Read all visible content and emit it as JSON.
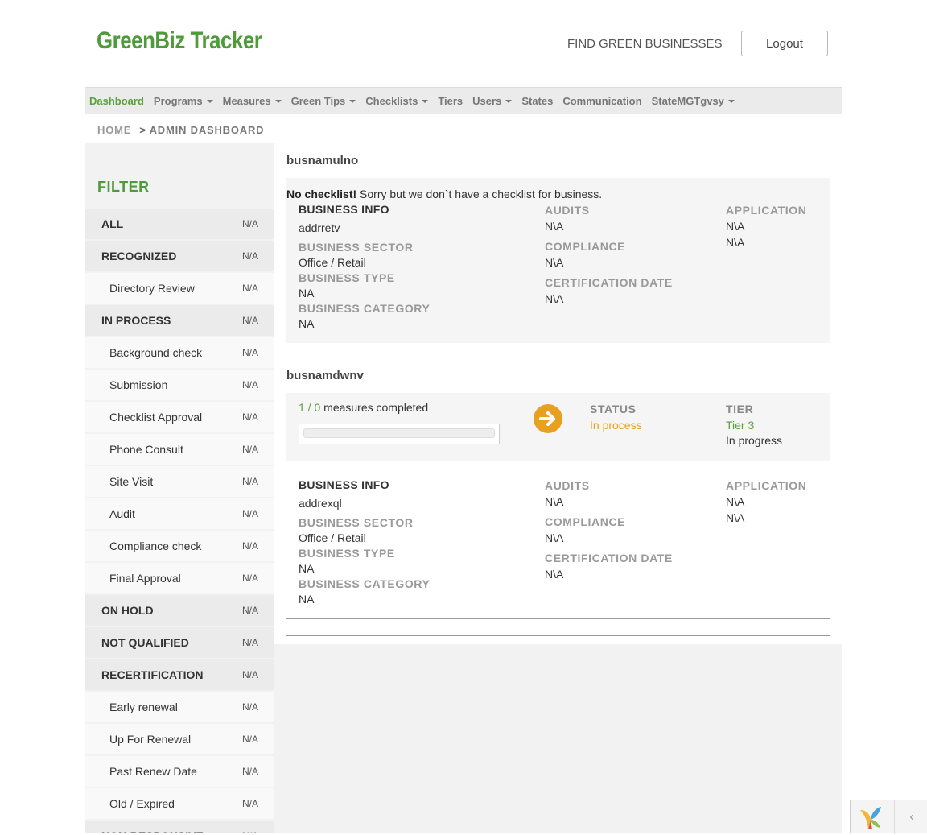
{
  "header": {
    "logo": "GreenBiz Tracker",
    "find_link": "FIND GREEN BUSINESSES",
    "logout": "Logout"
  },
  "nav": [
    {
      "label": "Dashboard",
      "active": true,
      "dropdown": false
    },
    {
      "label": "Programs",
      "dropdown": true
    },
    {
      "label": "Measures",
      "dropdown": true
    },
    {
      "label": "Green Tips",
      "dropdown": true
    },
    {
      "label": "Checklists",
      "dropdown": true
    },
    {
      "label": "Tiers",
      "dropdown": false
    },
    {
      "label": "Users",
      "dropdown": true
    },
    {
      "label": "States",
      "dropdown": false
    },
    {
      "label": "Communication",
      "dropdown": false
    },
    {
      "label": "StateMGTgvsy",
      "dropdown": true
    }
  ],
  "breadcrumb": {
    "home": "HOME",
    "separator": ">",
    "current": "ADMIN DASHBOARD"
  },
  "filter": {
    "title": "FILTER",
    "items": [
      {
        "label": "ALL",
        "value": "N/A",
        "level": "main"
      },
      {
        "label": "RECOGNIZED",
        "value": "N/A",
        "level": "main"
      },
      {
        "label": "Directory Review",
        "value": "N/A",
        "level": "sub"
      },
      {
        "label": "IN PROCESS",
        "value": "N/A",
        "level": "main"
      },
      {
        "label": "Background check",
        "value": "N/A",
        "level": "sub"
      },
      {
        "label": "Submission",
        "value": "N/A",
        "level": "sub"
      },
      {
        "label": "Checklist Approval",
        "value": "N/A",
        "level": "sub"
      },
      {
        "label": "Phone Consult",
        "value": "N/A",
        "level": "sub"
      },
      {
        "label": "Site Visit",
        "value": "N/A",
        "level": "sub"
      },
      {
        "label": "Audit",
        "value": "N/A",
        "level": "sub"
      },
      {
        "label": "Compliance check",
        "value": "N/A",
        "level": "sub"
      },
      {
        "label": "Final Approval",
        "value": "N/A",
        "level": "sub"
      },
      {
        "label": "ON HOLD",
        "value": "N/A",
        "level": "main"
      },
      {
        "label": "NOT QUALIFIED",
        "value": "N/A",
        "level": "main"
      },
      {
        "label": "RECERTIFICATION",
        "value": "N/A",
        "level": "main"
      },
      {
        "label": "Early renewal",
        "value": "N/A",
        "level": "sub"
      },
      {
        "label": "Up For Renewal",
        "value": "N/A",
        "level": "sub"
      },
      {
        "label": "Past Renew Date",
        "value": "N/A",
        "level": "sub"
      },
      {
        "label": "Old / Expired",
        "value": "N/A",
        "level": "sub"
      },
      {
        "label": "NON-RESPONSIVE",
        "value": "N/A",
        "level": "main"
      }
    ]
  },
  "businesses": [
    {
      "name": "busnamulno",
      "notice_bold": "No checklist!",
      "notice_text": " Sorry but we don`t have a checklist for business.",
      "business_info_label": "BUSINESS INFO",
      "address": "addrretv",
      "sector_label": "BUSINESS SECTOR",
      "sector": "Office / Retail",
      "type_label": "BUSINESS TYPE",
      "type": "NA",
      "category_label": "BUSINESS CATEGORY",
      "category": "NA",
      "audits_label": "AUDITS",
      "audits": "N\\A",
      "compliance_label": "COMPLIANCE",
      "compliance": "N\\A",
      "cert_label": "CERTIFICATION DATE",
      "cert_date": "N\\A",
      "application_label": "APPLICATION",
      "application_1": "N\\A",
      "application_2": "N\\A"
    },
    {
      "name": "busnamdwnv",
      "measures_done": "1",
      "measures_sep": " / ",
      "measures_total": "0",
      "measures_text": " measures completed",
      "progress_fraction": 0,
      "status_label": "STATUS",
      "status": "In process",
      "tier_label": "TIER",
      "tier": "Tier 3",
      "tier_status": "In progress",
      "business_info_label": "BUSINESS INFO",
      "address": "addrexql",
      "sector_label": "BUSINESS SECTOR",
      "sector": "Office / Retail",
      "type_label": "BUSINESS TYPE",
      "type": "NA",
      "category_label": "BUSINESS CATEGORY",
      "category": "NA",
      "audits_label": "AUDITS",
      "audits": "N\\A",
      "compliance_label": "COMPLIANCE",
      "compliance": "N\\A",
      "cert_label": "CERTIFICATION DATE",
      "cert_date": "N\\A",
      "application_label": "APPLICATION",
      "application_1": "N\\A",
      "application_2": "N\\A"
    }
  ],
  "colors": {
    "brand_green": "#4f9a3b",
    "status_orange": "#e8a020",
    "nav_bg": "#ebebeb"
  },
  "icons": {
    "arrow": "arrow-right-circle-icon",
    "caret": "caret-down-icon",
    "framework_logo": "yii-logo-icon",
    "collapse": "chevron-left-icon"
  }
}
